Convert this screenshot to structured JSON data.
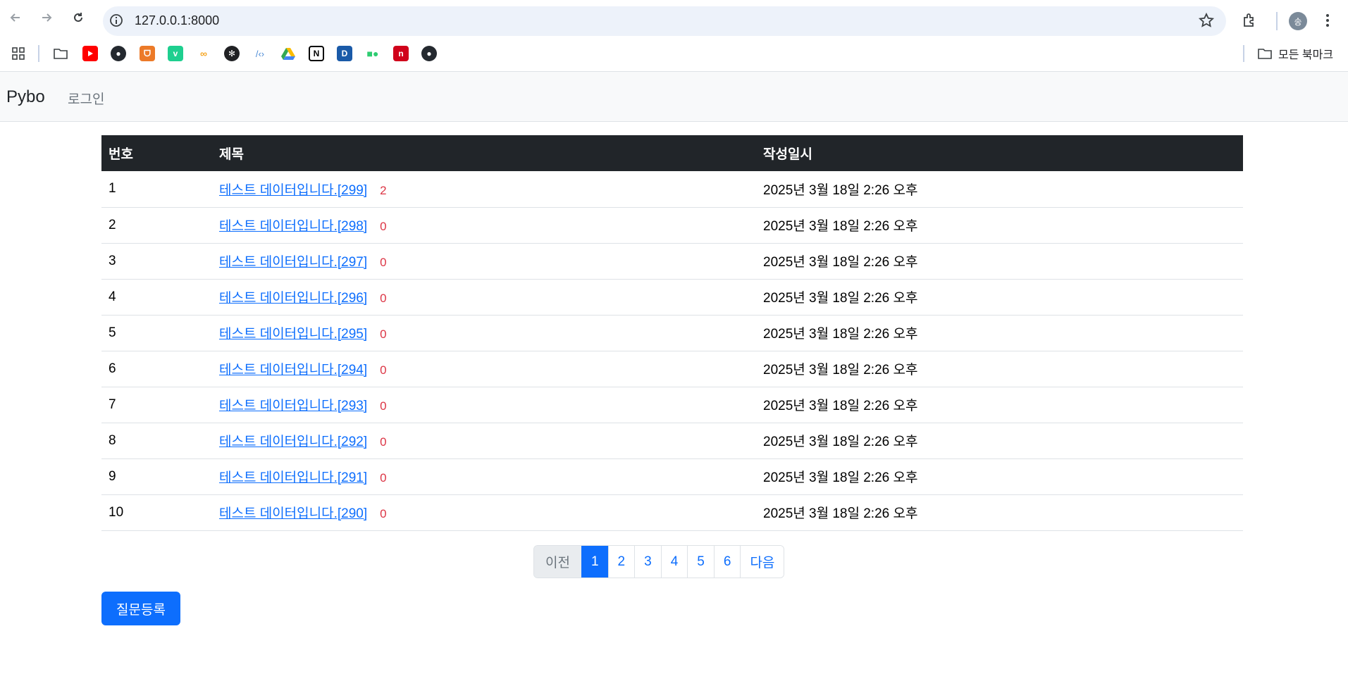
{
  "browser": {
    "url": "127.0.0.1:8000",
    "profile_initial": "송",
    "all_bookmarks_label": "모든 북마크",
    "bookmarks": [
      {
        "name": "apps-grid-icon",
        "color": "#3c4043"
      },
      {
        "name": "folder-icon",
        "color": "#3c4043"
      },
      {
        "name": "youtube-icon",
        "color": "#ff0000"
      },
      {
        "name": "github-icon",
        "color": "#24292f"
      },
      {
        "name": "fox-icon",
        "color": "#ec7a28"
      },
      {
        "name": "v-icon",
        "color": "#1ecf8f"
      },
      {
        "name": "co-icon",
        "color": "#f5a623"
      },
      {
        "name": "openai-icon",
        "color": "#202124"
      },
      {
        "name": "code-icon",
        "color": "#4b8bd6"
      },
      {
        "name": "drive-icon",
        "color": "#34a853"
      },
      {
        "name": "notion-icon",
        "color": "#000000"
      },
      {
        "name": "d-icon",
        "color": "#1a5aa8"
      },
      {
        "name": "dots-icon",
        "color": "#2ecc71"
      },
      {
        "name": "n-icon",
        "color": "#d0021b"
      },
      {
        "name": "github2-icon",
        "color": "#24292f"
      }
    ]
  },
  "navbar": {
    "brand": "Pybo",
    "login": "로그인"
  },
  "table": {
    "headers": {
      "num": "번호",
      "title": "제목",
      "date": "작성일시"
    },
    "rows": [
      {
        "num": "1",
        "title": "테스트 데이터입니다.[299]",
        "answers": "2",
        "date": "2025년 3월 18일 2:26 오후"
      },
      {
        "num": "2",
        "title": "테스트 데이터입니다.[298]",
        "answers": "0",
        "date": "2025년 3월 18일 2:26 오후"
      },
      {
        "num": "3",
        "title": "테스트 데이터입니다.[297]",
        "answers": "0",
        "date": "2025년 3월 18일 2:26 오후"
      },
      {
        "num": "4",
        "title": "테스트 데이터입니다.[296]",
        "answers": "0",
        "date": "2025년 3월 18일 2:26 오후"
      },
      {
        "num": "5",
        "title": "테스트 데이터입니다.[295]",
        "answers": "0",
        "date": "2025년 3월 18일 2:26 오후"
      },
      {
        "num": "6",
        "title": "테스트 데이터입니다.[294]",
        "answers": "0",
        "date": "2025년 3월 18일 2:26 오후"
      },
      {
        "num": "7",
        "title": "테스트 데이터입니다.[293]",
        "answers": "0",
        "date": "2025년 3월 18일 2:26 오후"
      },
      {
        "num": "8",
        "title": "테스트 데이터입니다.[292]",
        "answers": "0",
        "date": "2025년 3월 18일 2:26 오후"
      },
      {
        "num": "9",
        "title": "테스트 데이터입니다.[291]",
        "answers": "0",
        "date": "2025년 3월 18일 2:26 오후"
      },
      {
        "num": "10",
        "title": "테스트 데이터입니다.[290]",
        "answers": "0",
        "date": "2025년 3월 18일 2:26 오후"
      }
    ]
  },
  "pagination": {
    "prev": "이전",
    "pages": [
      "1",
      "2",
      "3",
      "4",
      "5",
      "6"
    ],
    "active_page": "1",
    "next": "다음"
  },
  "actions": {
    "create_question": "질문등록"
  },
  "colors": {
    "primary": "#0d6efd",
    "danger": "#dc3545",
    "header_dark": "#212529"
  }
}
